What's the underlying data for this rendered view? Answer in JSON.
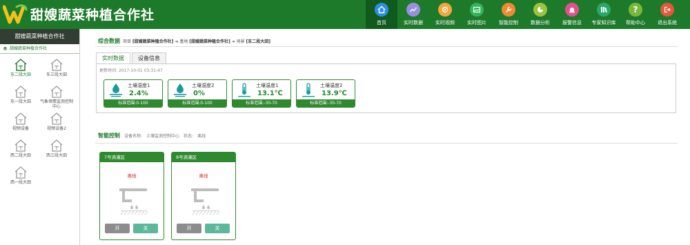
{
  "app": {
    "title": "甜嫂蔬菜种植合作社"
  },
  "nav": [
    {
      "label": "首页",
      "icon": "home-icon",
      "color": "#2a8ee6",
      "active": true
    },
    {
      "label": "实时数据",
      "icon": "line-chart-icon",
      "color": "#9b8ee0"
    },
    {
      "label": "实时视频",
      "icon": "camera-icon",
      "color": "#f3a63a"
    },
    {
      "label": "实时图片",
      "icon": "image-icon",
      "color": "#33b35a"
    },
    {
      "label": "智能控制",
      "icon": "wrench-icon",
      "color": "#f08a2e"
    },
    {
      "label": "数据分析",
      "icon": "pie-chart-icon",
      "color": "#9cc33a"
    },
    {
      "label": "报警信息",
      "icon": "alarm-icon",
      "color": "#e84e8a"
    },
    {
      "label": "专家知识库",
      "icon": "books-icon",
      "color": "#2aa86a"
    },
    {
      "label": "帮助中心",
      "icon": "question-icon",
      "color": "#7ab83a"
    },
    {
      "label": "退出系统",
      "icon": "exit-icon",
      "color": "#e8563a"
    }
  ],
  "sidebar": {
    "title": "甜嫂蔬菜种植合作社",
    "subtitle": "甜嫂蔬菜种植合作社",
    "items": [
      {
        "label": "东二段大田",
        "active": true
      },
      {
        "label": "东三段大田"
      },
      {
        "label": "东一段大田"
      },
      {
        "label": "气象墒情监测控制中心"
      },
      {
        "label": "视频设备"
      },
      {
        "label": "视频设备2"
      },
      {
        "label": "西二段大田"
      },
      {
        "label": "西三段大田"
      },
      {
        "label": "西一段大田"
      }
    ]
  },
  "overview": {
    "title": "综合数据",
    "crumb_project_label": "项目",
    "crumb_project": "[甜嫂蔬菜种植合作社]",
    "crumb_base_label": "基地",
    "crumb_base": "[甜嫂蔬菜种植合作社]",
    "crumb_field_label": "场景",
    "crumb_field": "[东二段大田]"
  },
  "tabs": [
    {
      "label": "实时数据",
      "active": true
    },
    {
      "label": "设备信息"
    }
  ],
  "update": {
    "label": "更新时间:",
    "value": "2017-10-01 03:31:47"
  },
  "sensors": [
    {
      "name": "土壤湿度1",
      "value": "2.4%",
      "range": "标准范围:0-100",
      "icon": "soil-moisture-icon"
    },
    {
      "name": "土壤湿度2",
      "value": "0%",
      "range": "标准范围:0-100",
      "icon": "soil-moisture-icon"
    },
    {
      "name": "土壤温度1",
      "value": "13.1℃",
      "range": "标准范围:-30-70",
      "icon": "soil-thermometer-icon"
    },
    {
      "name": "土壤温度2",
      "value": "13.9℃",
      "range": "标准范围:-30-70",
      "icon": "soil-thermometer-icon"
    }
  ],
  "control": {
    "title": "智能控制",
    "device_label": "设备名称:",
    "device": "土壤监测控制中心",
    "status_label": "状态:",
    "status": "离线",
    "devices": [
      {
        "name": "7号滴灌区",
        "status": "离线",
        "on": "开",
        "off": "关"
      },
      {
        "name": "8号滴灌区",
        "status": "离线",
        "on": "开",
        "off": "关"
      }
    ]
  },
  "colors": {
    "brand": "#1e7a2b",
    "accent": "#2f8a2f",
    "offline": "#e02020",
    "off_button": "#5bb89a"
  }
}
